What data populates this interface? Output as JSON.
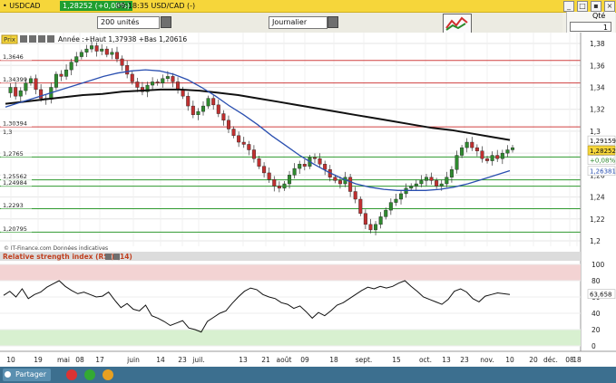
{
  "titlebar": {
    "symbol": "USDCAD",
    "change_badge": "1,28252 (+0,08%)",
    "clock_title": "09:18:35 USD/CAD (-)"
  },
  "toolbar": {
    "units": "200 unités",
    "period": "Journalier",
    "qty_label": "Qté",
    "qty_value": "1"
  },
  "legend": {
    "series": "Prix",
    "stats": "Année :+Haut 1,37938 +Bas 1,20616",
    "source": "© IT-Finance.com Données indicatives"
  },
  "rsi": {
    "title": "Relative strength index (RSI) (14)",
    "value": 63.658,
    "value_label": "63,658",
    "levels": [
      "100",
      "80",
      "60",
      "40",
      "20",
      "0"
    ],
    "overbought": 80,
    "oversold": 20
  },
  "colors": {
    "up": "#2f8a2f",
    "down": "#c03030",
    "sma_short": "#2a4fb0",
    "sma_long": "#111111",
    "resistance": "#d04040",
    "support": "#2f9a2f",
    "rsi_band": "#f3d3d3",
    "rsi_band_low": "#d8f0d0"
  },
  "bottom": {
    "share_label": "Partager"
  },
  "chart_data": {
    "type": "candlestick",
    "title": "USDCAD",
    "ylim": [
      1.2,
      1.385
    ],
    "y_ticks": [
      "1,38",
      "1,36",
      "1,34",
      "1,32",
      "1,3",
      "1,28",
      "1,26",
      "1,24",
      "1,22",
      "1,2"
    ],
    "x_ticks": [
      "10",
      "19",
      "mai",
      "08",
      "17",
      "juin",
      "14",
      "23",
      "juil.",
      "13",
      "21",
      "août",
      "09",
      "18",
      "sept.",
      "15",
      "oct.",
      "13",
      "23",
      "nov.",
      "10",
      "20",
      "déc.",
      "08",
      "18"
    ],
    "horizontal_levels": [
      {
        "value": 1.3646,
        "label": "1,3646",
        "kind": "resistance"
      },
      {
        "value": 1.34399,
        "label": "1,34399",
        "kind": "resistance"
      },
      {
        "value": 1.30394,
        "label": "1,30394",
        "kind": "resistance"
      },
      {
        "value": 1.2765,
        "label": "1,2765",
        "kind": "support"
      },
      {
        "value": 1.25562,
        "label": "1,25562",
        "kind": "support"
      },
      {
        "value": 1.24984,
        "label": "1,24984",
        "kind": "support"
      },
      {
        "value": 1.2293,
        "label": "1,2293",
        "kind": "support"
      },
      {
        "value": 1.20795,
        "label": "1,20795",
        "kind": "support"
      }
    ],
    "right_labels": [
      {
        "value": 1.29159,
        "label": "1,29159",
        "color": "#111111"
      },
      {
        "value": 1.28252,
        "label": "1,28252",
        "color": "#f6d63a"
      },
      {
        "value": 1.2738,
        "label": "+0,08%",
        "color": "#2f8a2f"
      },
      {
        "value": 1.26381,
        "label": "1,26381",
        "color": "#2a4fb0"
      }
    ],
    "close_points": [
      1.335,
      1.34,
      1.332,
      1.337,
      1.344,
      1.348,
      1.338,
      1.33,
      1.329,
      1.34,
      1.352,
      1.35,
      1.356,
      1.363,
      1.368,
      1.372,
      1.375,
      1.378,
      1.373,
      1.375,
      1.37,
      1.372,
      1.366,
      1.36,
      1.352,
      1.345,
      1.34,
      1.336,
      1.342,
      1.345,
      1.344,
      1.348,
      1.35,
      1.345,
      1.338,
      1.332,
      1.323,
      1.315,
      1.318,
      1.323,
      1.33,
      1.324,
      1.316,
      1.31,
      1.302,
      1.296,
      1.29,
      1.288,
      1.283,
      1.275,
      1.268,
      1.262,
      1.256,
      1.25,
      1.248,
      1.252,
      1.26,
      1.266,
      1.27,
      1.268,
      1.276,
      1.275,
      1.27,
      1.265,
      1.258,
      1.255,
      1.252,
      1.258,
      1.245,
      1.238,
      1.225,
      1.215,
      1.21,
      1.215,
      1.222,
      1.228,
      1.235,
      1.238,
      1.243,
      1.248,
      1.25,
      1.252,
      1.255,
      1.258,
      1.255,
      1.25,
      1.252,
      1.258,
      1.265,
      1.278,
      1.285,
      1.29,
      1.285,
      1.282,
      1.275,
      1.273,
      1.278,
      1.275,
      1.28,
      1.283,
      1.285
    ],
    "sma_short_points": [
      1.322,
      1.326,
      1.33,
      1.334,
      1.338,
      1.342,
      1.346,
      1.35,
      1.353,
      1.355,
      1.356,
      1.355,
      1.352,
      1.347,
      1.34,
      1.332,
      1.323,
      1.315,
      1.306,
      1.296,
      1.287,
      1.278,
      1.27,
      1.263,
      1.257,
      1.252,
      1.249,
      1.247,
      1.246,
      1.246,
      1.246,
      1.247,
      1.249,
      1.252,
      1.256,
      1.26,
      1.264
    ],
    "sma_long_points": [
      1.325,
      1.327,
      1.329,
      1.331,
      1.333,
      1.334,
      1.336,
      1.337,
      1.338,
      1.338,
      1.337,
      1.335,
      1.333,
      1.33,
      1.327,
      1.324,
      1.321,
      1.318,
      1.315,
      1.312,
      1.309,
      1.306,
      1.303,
      1.301,
      1.298,
      1.295,
      1.292
    ],
    "rsi_points": [
      62,
      67,
      60,
      70,
      58,
      63,
      66,
      72,
      76,
      80,
      73,
      68,
      64,
      66,
      63,
      60,
      61,
      66,
      56,
      47,
      52,
      45,
      43,
      50,
      37,
      34,
      30,
      25,
      28,
      31,
      22,
      20,
      17,
      30,
      35,
      40,
      43,
      52,
      60,
      67,
      71,
      69,
      63,
      60,
      58,
      53,
      51,
      46,
      49,
      42,
      34,
      41,
      37,
      43,
      50,
      53,
      58,
      63,
      68,
      72,
      70,
      73,
      71,
      73,
      77,
      80,
      73,
      67,
      60,
      57,
      54,
      51,
      57,
      67,
      70,
      66,
      58,
      54,
      61,
      63,
      65,
      64,
      63
    ]
  }
}
